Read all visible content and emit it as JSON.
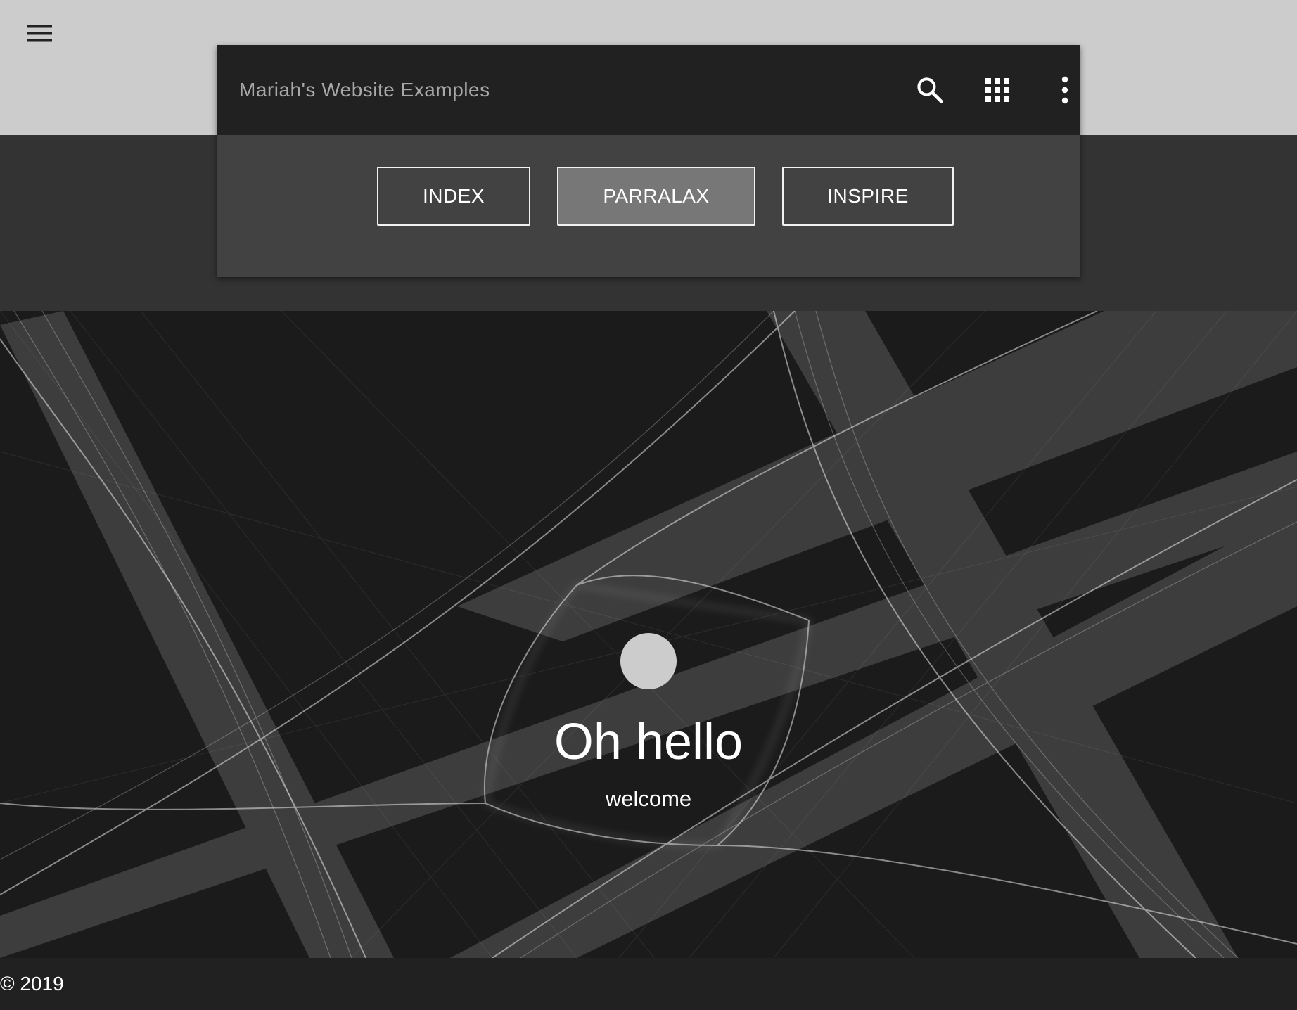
{
  "app": {
    "title": "Mariah's Website Examples"
  },
  "toolbar": {
    "icons": [
      "search-icon",
      "apps-grid-icon",
      "more-vert-icon"
    ]
  },
  "nav": {
    "buttons": [
      {
        "label": "INDEX",
        "active": false
      },
      {
        "label": "PARRALAX",
        "active": true
      },
      {
        "label": "INSPIRE",
        "active": false
      }
    ]
  },
  "hero": {
    "title": "Oh hello",
    "subtitle": "welcome"
  },
  "footer": {
    "copyright": "© 2019"
  },
  "colors": {
    "top_band": "#cccccc",
    "toolbar": "#212121",
    "card_body": "#424242",
    "dark_band": "#333333",
    "hero_bg": "#1b1b1b",
    "active_button": "#777777",
    "footer": "#212121"
  }
}
